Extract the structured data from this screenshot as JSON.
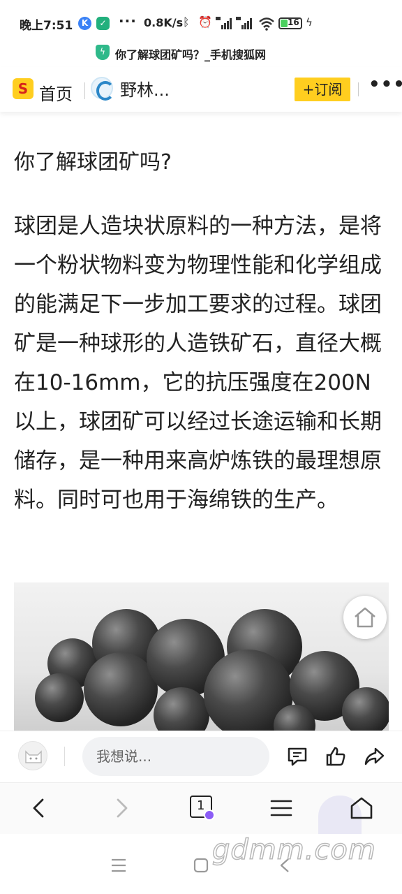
{
  "status_bar": {
    "time": "晚上7:51",
    "net_speed": "0.8K/s",
    "battery_level": "16",
    "icons": [
      "k-app-icon",
      "shield-app-icon",
      "bluetooth-icon",
      "alarm-icon",
      "hd-signal-icon",
      "hd-signal-icon-2",
      "wifi-icon",
      "battery-icon",
      "charging-icon"
    ]
  },
  "url_bar": {
    "page_title": "你了解球团矿吗？_手机搜狐网"
  },
  "site_header": {
    "logo_letter": "S",
    "home_label": "首页",
    "channel_name": "野林...",
    "subscribe_label": "+订阅",
    "more_label": "•••"
  },
  "article": {
    "title": "你了解球团矿吗?",
    "body": "球团是人造块状原料的一种方法，是将一个粉状物料变为物理性能和化学组成的能满足下一步加工要求的过程。球团矿是一种球形的人造铁矿石，直径大概在10-16mm，它的抗压强度在200N以上，球团矿可以经过长途运输和长期储存，是一种用来高炉炼铁的最理想原料。同时可也用于海绵铁的生产。"
  },
  "comment_bar": {
    "input_placeholder": "我想说..."
  },
  "browser_bar": {
    "tab_count": "1"
  },
  "watermark": "gdmm.com",
  "colors": {
    "brand_yellow": "#ffce1f",
    "text": "#222222",
    "shield_green": "#2fb98a",
    "tab_badge_purple": "#8b5cf6"
  }
}
